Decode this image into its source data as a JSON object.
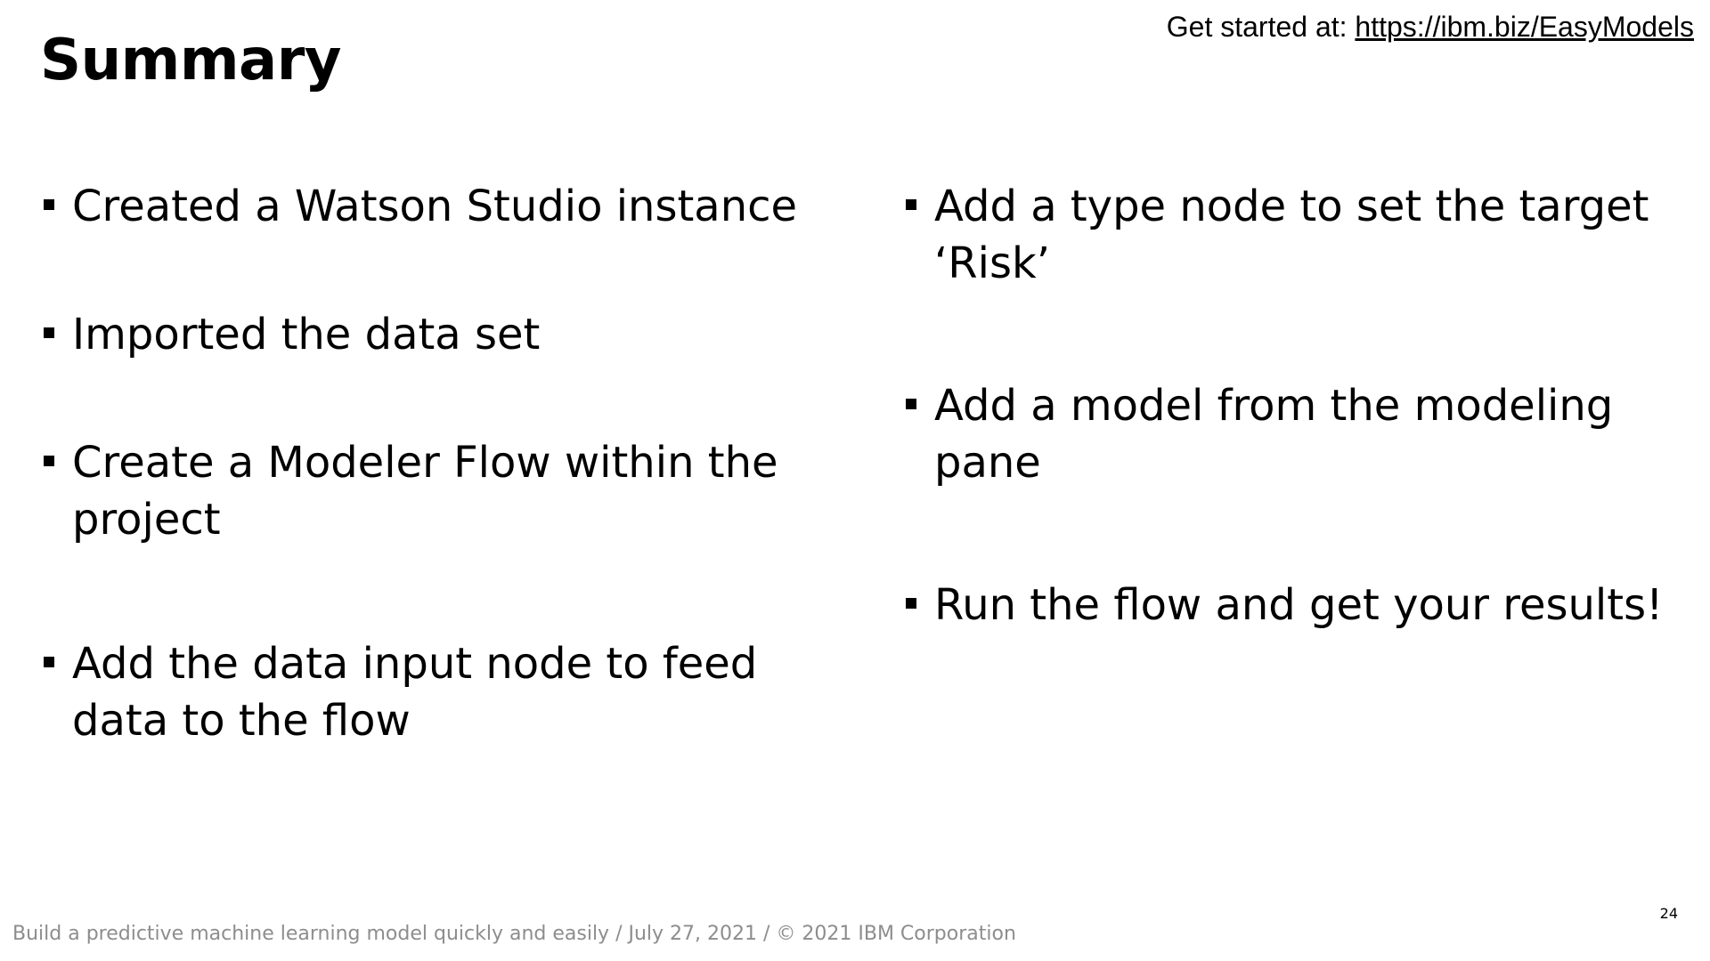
{
  "header": {
    "title": "Summary",
    "get_started_label": "Get started at:",
    "get_started_link": "https://ibm.biz/EasyModels"
  },
  "left_bullets": [
    {
      "text": "Created a Watson Studio instance"
    },
    {
      "text": "Imported the data set"
    },
    {
      "text": "Create a Modeler Flow within the project"
    },
    {
      "text": "Add the data input node to feed data to the flow"
    }
  ],
  "right_bullets": [
    {
      "text": "Add a type node to set the target ‘Risk’"
    },
    {
      "text": "Add a model from the modeling pane"
    },
    {
      "text": "Run the flow and get your results!"
    }
  ],
  "footer": {
    "text": "Build a predictive machine learning model quickly and easily / July 27, 2021 / © 2021 IBM Corporation",
    "page_number": "24"
  }
}
